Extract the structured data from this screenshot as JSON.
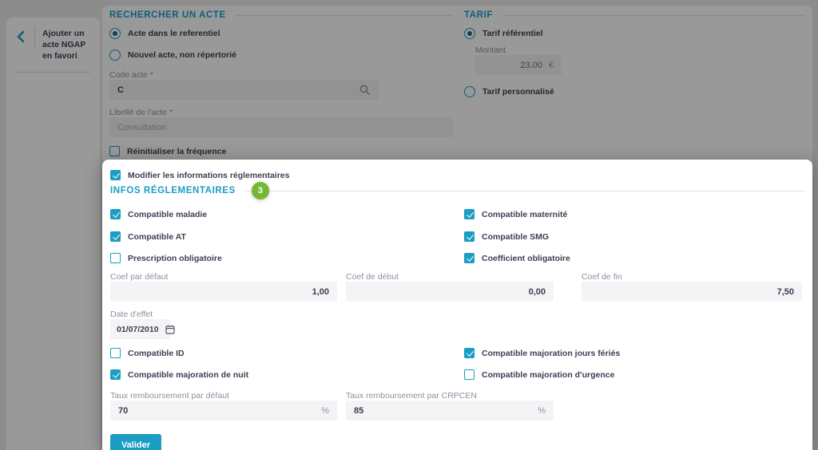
{
  "colors": {
    "accent": "#1b9dc4",
    "badge_green": "#76b831",
    "radio_dot": "#1f6f8e"
  },
  "sidebar": {
    "back_icon": "chevron-left",
    "title_line1": "Ajouter un acte NGAP",
    "title_line2": "en favori"
  },
  "search_section": {
    "title": "RECHERCHER UN ACTE",
    "radio_referentiel": {
      "label": "Acte dans le referentiel",
      "selected": true
    },
    "radio_nouvel": {
      "label": "Nouvel acte, non répertorié",
      "selected": false
    },
    "code": {
      "label": "Code acte *",
      "value": "C",
      "icon": "search-magnifier"
    },
    "libelle": {
      "label": "Libellé de l'acte *",
      "value": "Consultation"
    },
    "reinit": {
      "label": "Réinitialiser la fréquence",
      "checked": false
    }
  },
  "tarif_section": {
    "title": "TARIF",
    "radio_referentiel": {
      "label": "Tarif référentiel",
      "selected": true
    },
    "montant": {
      "label": "Montant",
      "value": "23.00",
      "suffix": "€"
    },
    "radio_personnalise": {
      "label": "Tarif personnalisé",
      "selected": false
    }
  },
  "panel": {
    "modify": {
      "label": "Modifier les informations réglementaires",
      "checked": true
    },
    "title": "INFOS RÉGLEMENTAIRES",
    "badge": "3",
    "checks": [
      {
        "label": "Compatible maladie",
        "checked": true
      },
      {
        "label": "Compatible maternité",
        "checked": true
      },
      {
        "label": "Compatible AT",
        "checked": true
      },
      {
        "label": "Compatible SMG",
        "checked": true
      },
      {
        "label": "Prescription obligatoire",
        "checked": false
      },
      {
        "label": "Coefficient obligatoire",
        "checked": true
      }
    ],
    "coef": [
      {
        "label": "Coef par défaut",
        "value": "1,00"
      },
      {
        "label": "Coef de début",
        "value": "0,00"
      },
      {
        "label": "Coef de fin",
        "value": "7,50"
      }
    ],
    "date": {
      "label": "Date d'effet",
      "value": "01/07/2010",
      "icon": "calendar"
    },
    "checks2": [
      {
        "label": "Compatible ID",
        "checked": false
      },
      {
        "label": "Compatible majoration jours fériés",
        "checked": true
      },
      {
        "label": "Compatible majoration de nuit",
        "checked": true
      },
      {
        "label": "Compatible majoration d'urgence",
        "checked": false
      }
    ],
    "taux": [
      {
        "label": "Taux remboursement par défaut",
        "value": "70",
        "suffix": "%"
      },
      {
        "label": "Taux remboursement par CRPCEN",
        "value": "85",
        "suffix": "%"
      }
    ],
    "submit": "Valider"
  }
}
